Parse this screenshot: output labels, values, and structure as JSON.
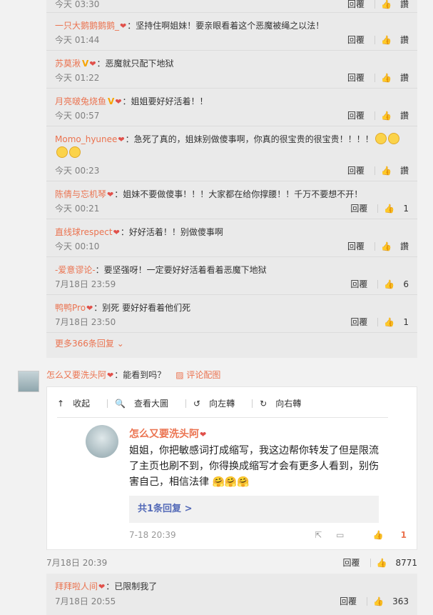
{
  "labels": {
    "reply": "回覆",
    "like": "讚"
  },
  "first_row": {
    "time": "今天 03:30"
  },
  "replies": [
    {
      "user": "一只大鹅鹅鹅鹅_",
      "text": "：坚持住啊姐妹！要亲眼看着这个恶魔被绳之以法！",
      "time": "今天 01:44",
      "likes": ""
    },
    {
      "user": "苏莫湫",
      "text": "：恶魔就只配下地狱",
      "time": "今天 01:22",
      "likes": ""
    },
    {
      "user": "月亮啵兔烧鱼",
      "text": "：姐姐要好好活着！！",
      "time": "今天 00:57",
      "likes": ""
    },
    {
      "user": "Momo_hyunee",
      "text": "：急死了真的，姐妹别做傻事啊，你真的很宝贵的很宝贵！！！！",
      "time": "今天 00:23",
      "likes": ""
    },
    {
      "user": "陈倩与忘机琴",
      "text": "：姐妹不要做傻事！！！大家都在给你撑腰！！千万不要想不开！",
      "time": "今天 00:21",
      "likes": "1"
    },
    {
      "user": "直线球respect",
      "text": "：好好活着！！别做傻事啊",
      "time": "今天 00:10",
      "likes": ""
    },
    {
      "user": "-爱意谬论-",
      "text": "：要坚强呀！一定要好好活着看着恶魔下地狱",
      "time": "7月18日 23:59",
      "likes": "6"
    },
    {
      "user": "鸭鸭Pro",
      "text": "：别死 要好好看着他们死",
      "time": "7月18日 23:50",
      "likes": "1"
    }
  ],
  "more_replies": "更多366条回复",
  "main_comment": {
    "user": "怎么又要洗头阿",
    "text": "：能看到吗？",
    "pic_link": "评论配图",
    "time": "7月18日 20:39",
    "likes": "8771"
  },
  "toolbar": {
    "collapse": "收起",
    "view_large": "查看大圖",
    "rotate_left": "向左轉",
    "rotate_right": "向右轉"
  },
  "pic_comment": {
    "user": "怎么又要洗头阿",
    "text": "姐姐，你把敏感词打成缩写，我这边帮你转发了但是限流了主页也刷不到，你得换成缩写才会有更多人看到，别伤害自己，相信法律",
    "replies_link": "共1条回复 >",
    "time": "7-18 20:39",
    "likes": "1"
  },
  "sub_reply": {
    "user": "拜拜啦人间",
    "text": "：已限制我了",
    "time": "7月18日 20:55",
    "likes": "363"
  },
  "colors": {
    "username": "#eb7350",
    "link_blue": "#556bb8",
    "verified": "#f7a400"
  }
}
